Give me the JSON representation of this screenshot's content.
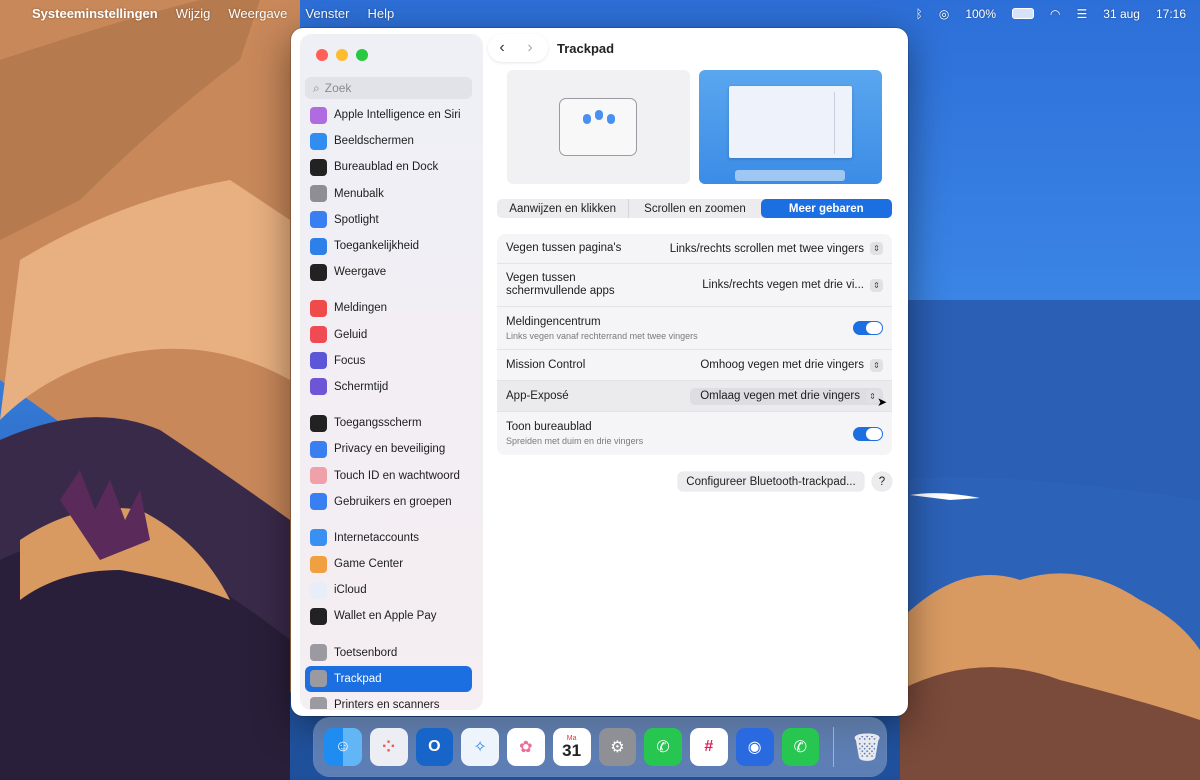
{
  "menubar": {
    "app_name": "Systeeminstellingen",
    "menus": [
      "Wijzig",
      "Weergave",
      "Venster",
      "Help"
    ],
    "battery": "100%",
    "date": "31 aug",
    "time": "17:16"
  },
  "window": {
    "title": "Trackpad",
    "search_placeholder": "Zoek",
    "sidebar_items": [
      {
        "label": "Apple Intelligence en Siri",
        "icon": "siri-icon",
        "color": "#b06be0"
      },
      {
        "label": "Beeldschermen",
        "icon": "sun-icon",
        "color": "#2f8ef0"
      },
      {
        "label": "Bureaublad en Dock",
        "icon": "dock-icon",
        "color": "#222222"
      },
      {
        "label": "Menubalk",
        "icon": "menubar-icon",
        "color": "#8e8e93"
      },
      {
        "label": "Spotlight",
        "icon": "magnifier-icon",
        "color": "#3a7ff2"
      },
      {
        "label": "Toegankelijkheid",
        "icon": "accessibility-icon",
        "color": "#2f7fe8"
      },
      {
        "label": "Weergave",
        "icon": "appearance-icon",
        "color": "#222222"
      },
      {
        "label": "Meldingen",
        "icon": "bell-icon",
        "color": "#ef4b4b"
      },
      {
        "label": "Geluid",
        "icon": "speaker-icon",
        "color": "#ef4b55"
      },
      {
        "label": "Focus",
        "icon": "moon-icon",
        "color": "#5b57d6"
      },
      {
        "label": "Schermtijd",
        "icon": "hourglass-icon",
        "color": "#6d55d6"
      },
      {
        "label": "Toegangsscherm",
        "icon": "lock-icon",
        "color": "#222222"
      },
      {
        "label": "Privacy en beveiliging",
        "icon": "hand-icon",
        "color": "#3a7ff2"
      },
      {
        "label": "Touch ID en wachtwoord",
        "icon": "fingerprint-icon",
        "color": "#f0a0a8"
      },
      {
        "label": "Gebruikers en groepen",
        "icon": "users-icon",
        "color": "#3a7ff2"
      },
      {
        "label": "Internetaccounts",
        "icon": "at-icon",
        "color": "#3a8ff2"
      },
      {
        "label": "Game Center",
        "icon": "gamecenter-icon",
        "color": "#f0a040"
      },
      {
        "label": "iCloud",
        "icon": "cloud-icon",
        "color": "#e8eef8"
      },
      {
        "label": "Wallet en Apple Pay",
        "icon": "wallet-icon",
        "color": "#222222"
      },
      {
        "label": "Toetsenbord",
        "icon": "keyboard-icon",
        "color": "#9a9aa0"
      },
      {
        "label": "Trackpad",
        "icon": "trackpad-icon",
        "color": "#9a9aa0"
      },
      {
        "label": "Printers en scanners",
        "icon": "printer-icon",
        "color": "#9a9aa0"
      }
    ],
    "tabs": [
      "Aanwijzen en klikken",
      "Scrollen en zoomen",
      "Meer gebaren"
    ],
    "active_tab": "Meer gebaren",
    "settings": [
      {
        "label": "Vegen tussen pagina's",
        "value": "Links/rechts scrollen met twee vingers"
      },
      {
        "label": "Vegen tussen schermvullende apps",
        "value": "Links/rechts vegen met drie vi..."
      },
      {
        "label": "Meldingencentrum",
        "description": "Links vegen vanaf rechterrand met twee vingers",
        "toggle": true
      },
      {
        "label": "Mission Control",
        "value": "Omhoog vegen met drie vingers"
      },
      {
        "label": "App-Exposé",
        "value": "Omlaag vegen met drie vingers"
      },
      {
        "label": "Toon bureaublad",
        "description": "Spreiden met duim en drie vingers",
        "toggle": true
      }
    ],
    "configure_button": "Configureer Bluetooth-trackpad...",
    "help_button": "?"
  },
  "dock": {
    "apps": [
      "Finder",
      "Launchpad",
      "Outlook",
      "Safari",
      "Foto's",
      "Agenda",
      "Systeeminstellingen",
      "WhatsApp",
      "Slack",
      "Dictionary",
      "WhatsApp Beta"
    ],
    "calendar_month": "Ma",
    "calendar_day": "31",
    "accent": "#1c6fe0"
  }
}
